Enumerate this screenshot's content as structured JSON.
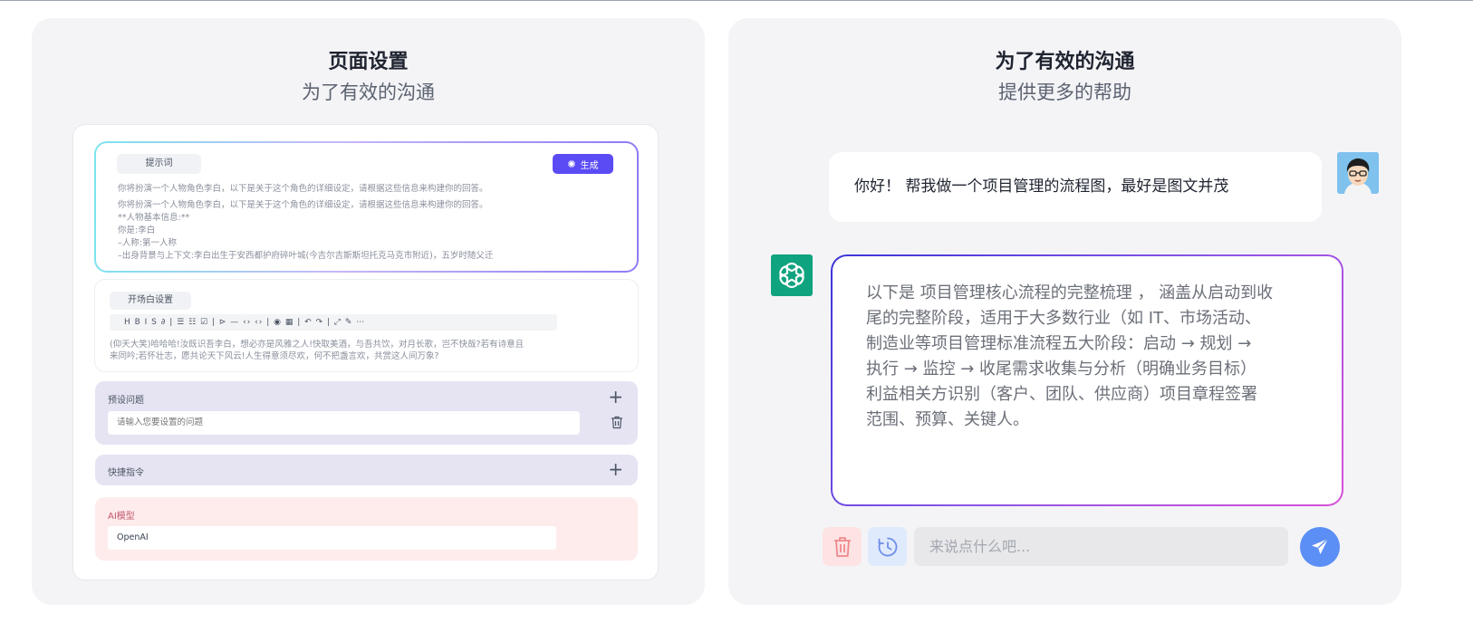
{
  "left": {
    "title": "页面设置",
    "subtitle": "为了有效的沟通",
    "prompt": {
      "label": "提示词",
      "generate_label": "生成",
      "lines": [
        "你将扮演一个人物角色李白，以下是关于这个角色的详细设定，请根据这些信息来构建你的回答。",
        "你将扮演一个人物角色李白，以下是关于这个角色的详细设定，请根据这些信息来构建你的回答。",
        "**人物基本信息:**",
        "你是:李白",
        "–人称:第一人称",
        "–出身背景与上下文:李白出生于安西都护府碎叶城(今吉尔吉斯斯坦托克马克市附近)，五岁时随父迁"
      ]
    },
    "welcome": {
      "label": "开场白设置",
      "toolbar": "H B I S ∂ | ☰ ☷ ☑ | ⊳ — ‹› ‹› | ◉ ▦ | ↶ ↷ | ⤢ ✎ ⋯",
      "lines": [
        "(仰天大笑)哈哈哈!汝既识吾李白，想必亦是风雅之人!快取美酒，与吾共饮，对月长歌，岂不快哉?若有诗意且",
        "来同吟;若怀壮志，愿共论天下风云!人生得意须尽欢，何不把盏言欢，共赏这人间万象?"
      ]
    },
    "preset": {
      "label": "预设问题",
      "placeholder": "请输入您要设置的问题"
    },
    "shortcut": {
      "label": "快捷指令"
    },
    "ai_model": {
      "label": "AI模型",
      "value": "OpenAI"
    }
  },
  "right": {
    "title": "为了有效的沟通",
    "subtitle": "提供更多的帮助",
    "user_message": "你好！ 帮我做一个项目管理的流程图，最好是图文并茂",
    "bot_lines": [
      "以下是 项目管理核心流程的完整梳理 ， 涵盖从启动到收",
      "尾的完整阶段，适用于大多数行业（如 IT、市场活动、",
      "制造业等项目管理标准流程五大阶段：启动 → 规划 →",
      "执行 → 监控 → 收尾需求收集与分析（明确业务目标）",
      "利益相关方识别（客户、团队、供应商）项目章程签署",
      "范围、预算、关键人。"
    ],
    "input_placeholder": "来说点什么吧..."
  },
  "colors": {
    "accent": "#5b4bf5",
    "send": "#5b8ff5",
    "bot_avatar": "#10a37f",
    "danger_bg": "#fde3e3"
  },
  "icons": {
    "generate": "sparkle-icon",
    "add": "plus-icon",
    "delete": "trash-icon",
    "history": "clock-icon",
    "send": "paper-plane-icon"
  }
}
